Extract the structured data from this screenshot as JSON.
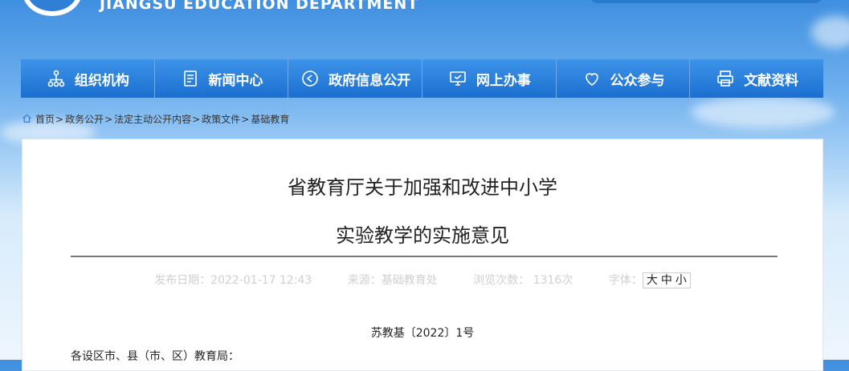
{
  "header": {
    "site_name_en": "JIANGSU EDUCATION DEPARTMENT"
  },
  "nav": {
    "items": [
      {
        "label": "组织机构",
        "icon": "org-chart-icon"
      },
      {
        "label": "新闻中心",
        "icon": "news-document-icon"
      },
      {
        "label": "政府信息公开",
        "icon": "play-circle-icon"
      },
      {
        "label": "网上办事",
        "icon": "monitor-icon"
      },
      {
        "label": "公众参与",
        "icon": "heart-icon"
      },
      {
        "label": "文献资料",
        "icon": "printer-icon"
      }
    ]
  },
  "breadcrumb": {
    "items": [
      "首页",
      "政务公开",
      "法定主动公开内容",
      "政策文件",
      "基础教育"
    ]
  },
  "article": {
    "title_line1": "省教育厅关于加强和改进中小学",
    "title_line2": "实验教学的实施意见",
    "meta": {
      "publish_date": "发布日期：2022-01-17 12:43",
      "source": "来源：基础教育处",
      "views": "浏览次数： 1316次",
      "font_label": "字体：",
      "font_sizes": [
        "大",
        "中",
        "小"
      ]
    },
    "doc_number": "苏教基〔2022〕1号",
    "recipient": "各设区市、县（市、区）教育局："
  },
  "colors": {
    "nav_bg": "#1b6fd0",
    "accent": "#3b7fd0"
  }
}
